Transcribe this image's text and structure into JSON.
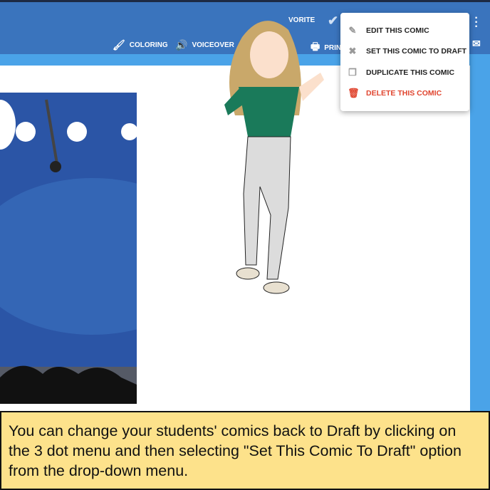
{
  "toolbar": {
    "favorite": "VORITE",
    "coloring": "COLORING",
    "voiceover": "VOICEOVER",
    "print": "PRIN"
  },
  "menu": {
    "items": [
      {
        "label": "EDIT THIS COMIC",
        "icon": "pencil-icon"
      },
      {
        "label": "SET THIS COMIC TO DRAFT",
        "icon": "draft-icon"
      },
      {
        "label": "DUPLICATE THIS COMIC",
        "icon": "copy-icon"
      },
      {
        "label": "DELETE THIS COMIC",
        "icon": "trash-icon"
      }
    ]
  },
  "caption": "You can change your students' comics back to Draft by clicking on the 3 dot menu and then selecting \"Set This Comic To Draft\" option from the drop-down menu.",
  "colors": {
    "header": "#3a74bd",
    "accent": "#4aa3e8",
    "delete": "#e0452f",
    "caption_bg": "#fde28b"
  }
}
